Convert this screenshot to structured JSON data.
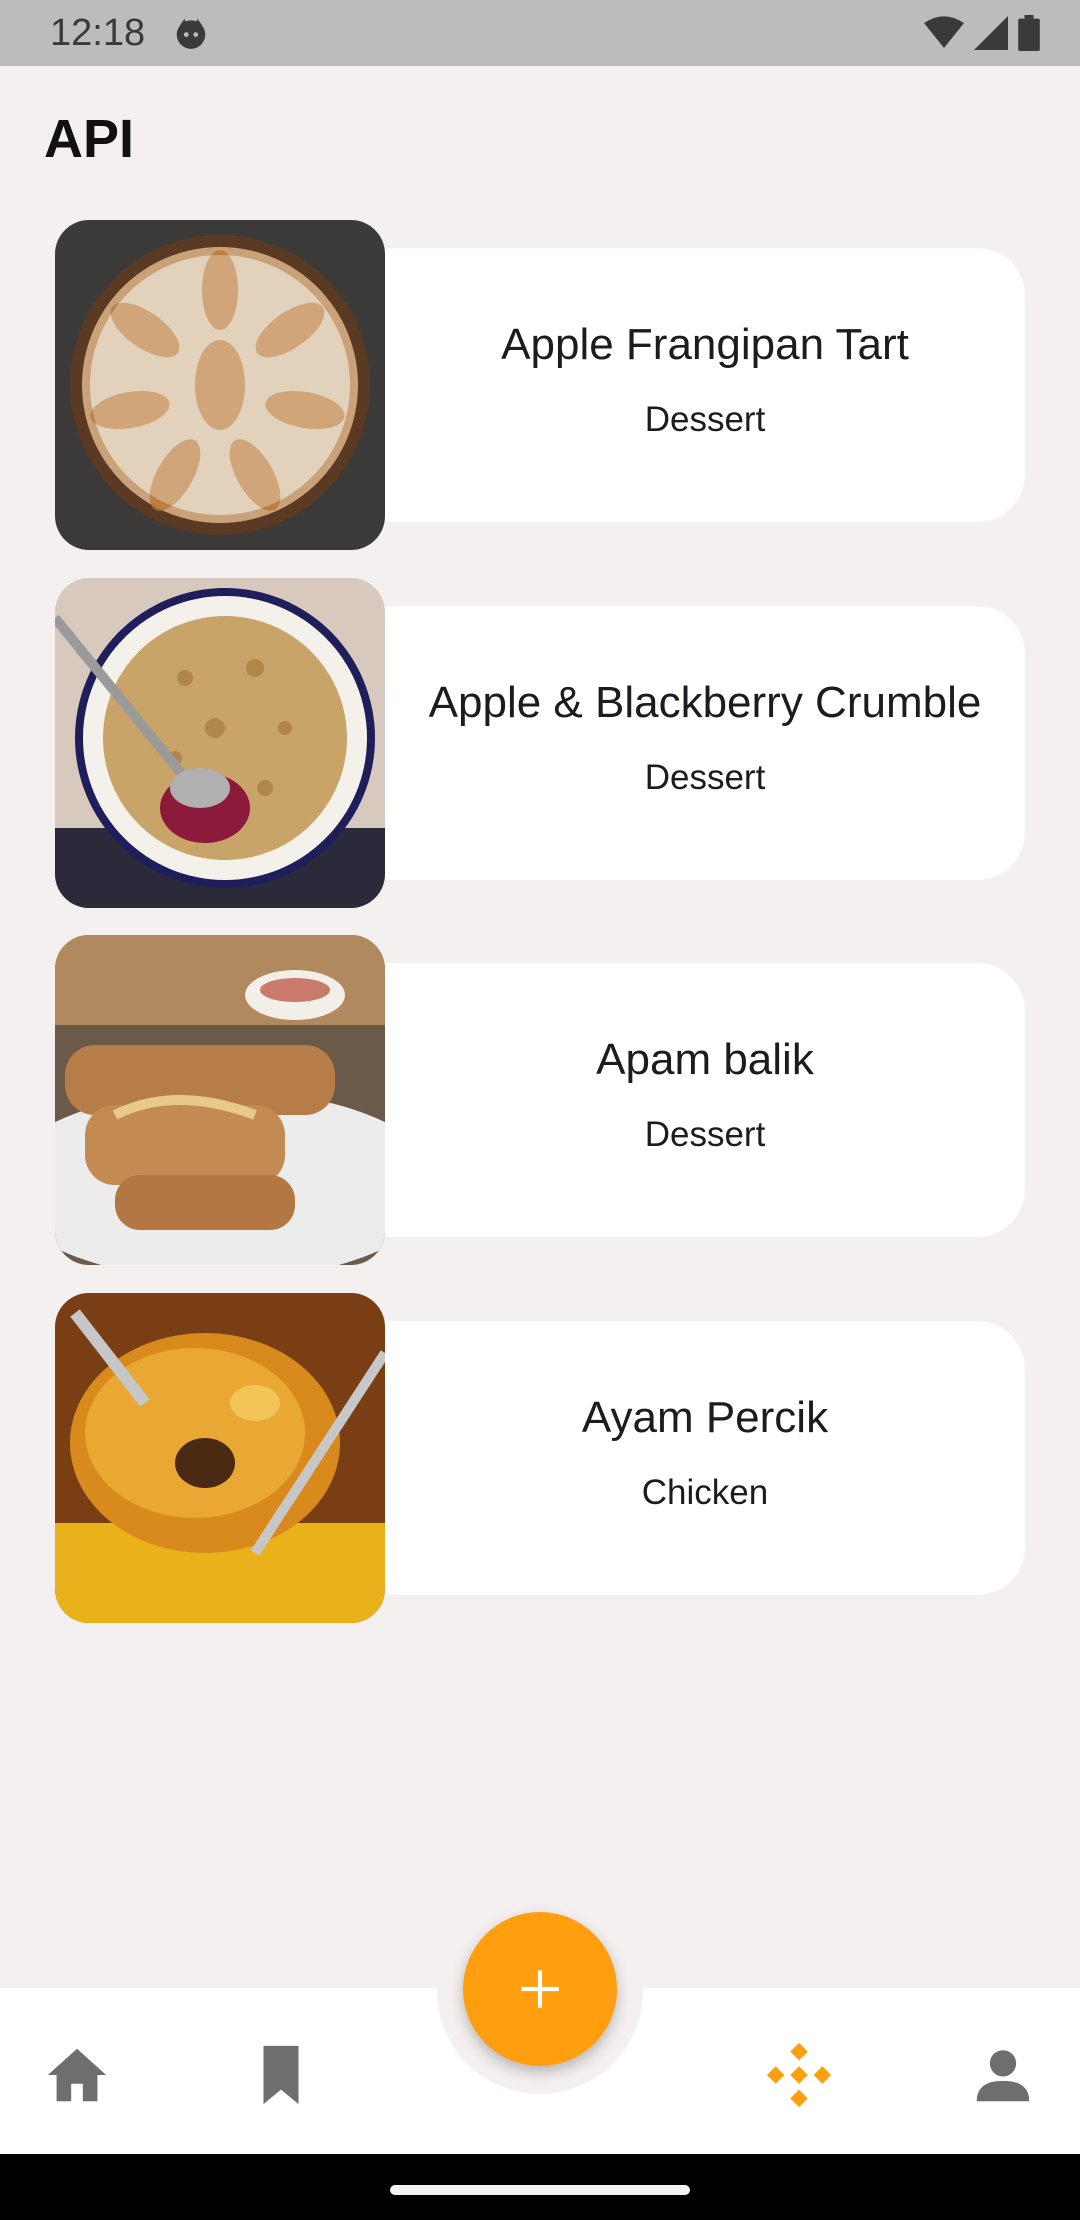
{
  "status": {
    "time": "12:18"
  },
  "header": {
    "title": "API"
  },
  "meals": [
    {
      "name": "Apple Frangipan Tart",
      "category": "Dessert"
    },
    {
      "name": "Apple & Blackberry Crumble",
      "category": "Dessert"
    },
    {
      "name": "Apam balik",
      "category": "Dessert"
    },
    {
      "name": "Ayam Percik",
      "category": "Chicken"
    }
  ],
  "nav": {
    "items": [
      {
        "icon": "home-icon",
        "active": false
      },
      {
        "icon": "bookmark-icon",
        "active": false
      },
      {
        "icon": "api-icon",
        "active": true
      },
      {
        "icon": "person-icon",
        "active": false
      }
    ],
    "fab_icon": "plus-icon"
  },
  "colors": {
    "accent": "#ff9f0f",
    "background": "#f5f0f0",
    "card": "#ffffff",
    "inactive_icon": "#6e6e6e"
  }
}
